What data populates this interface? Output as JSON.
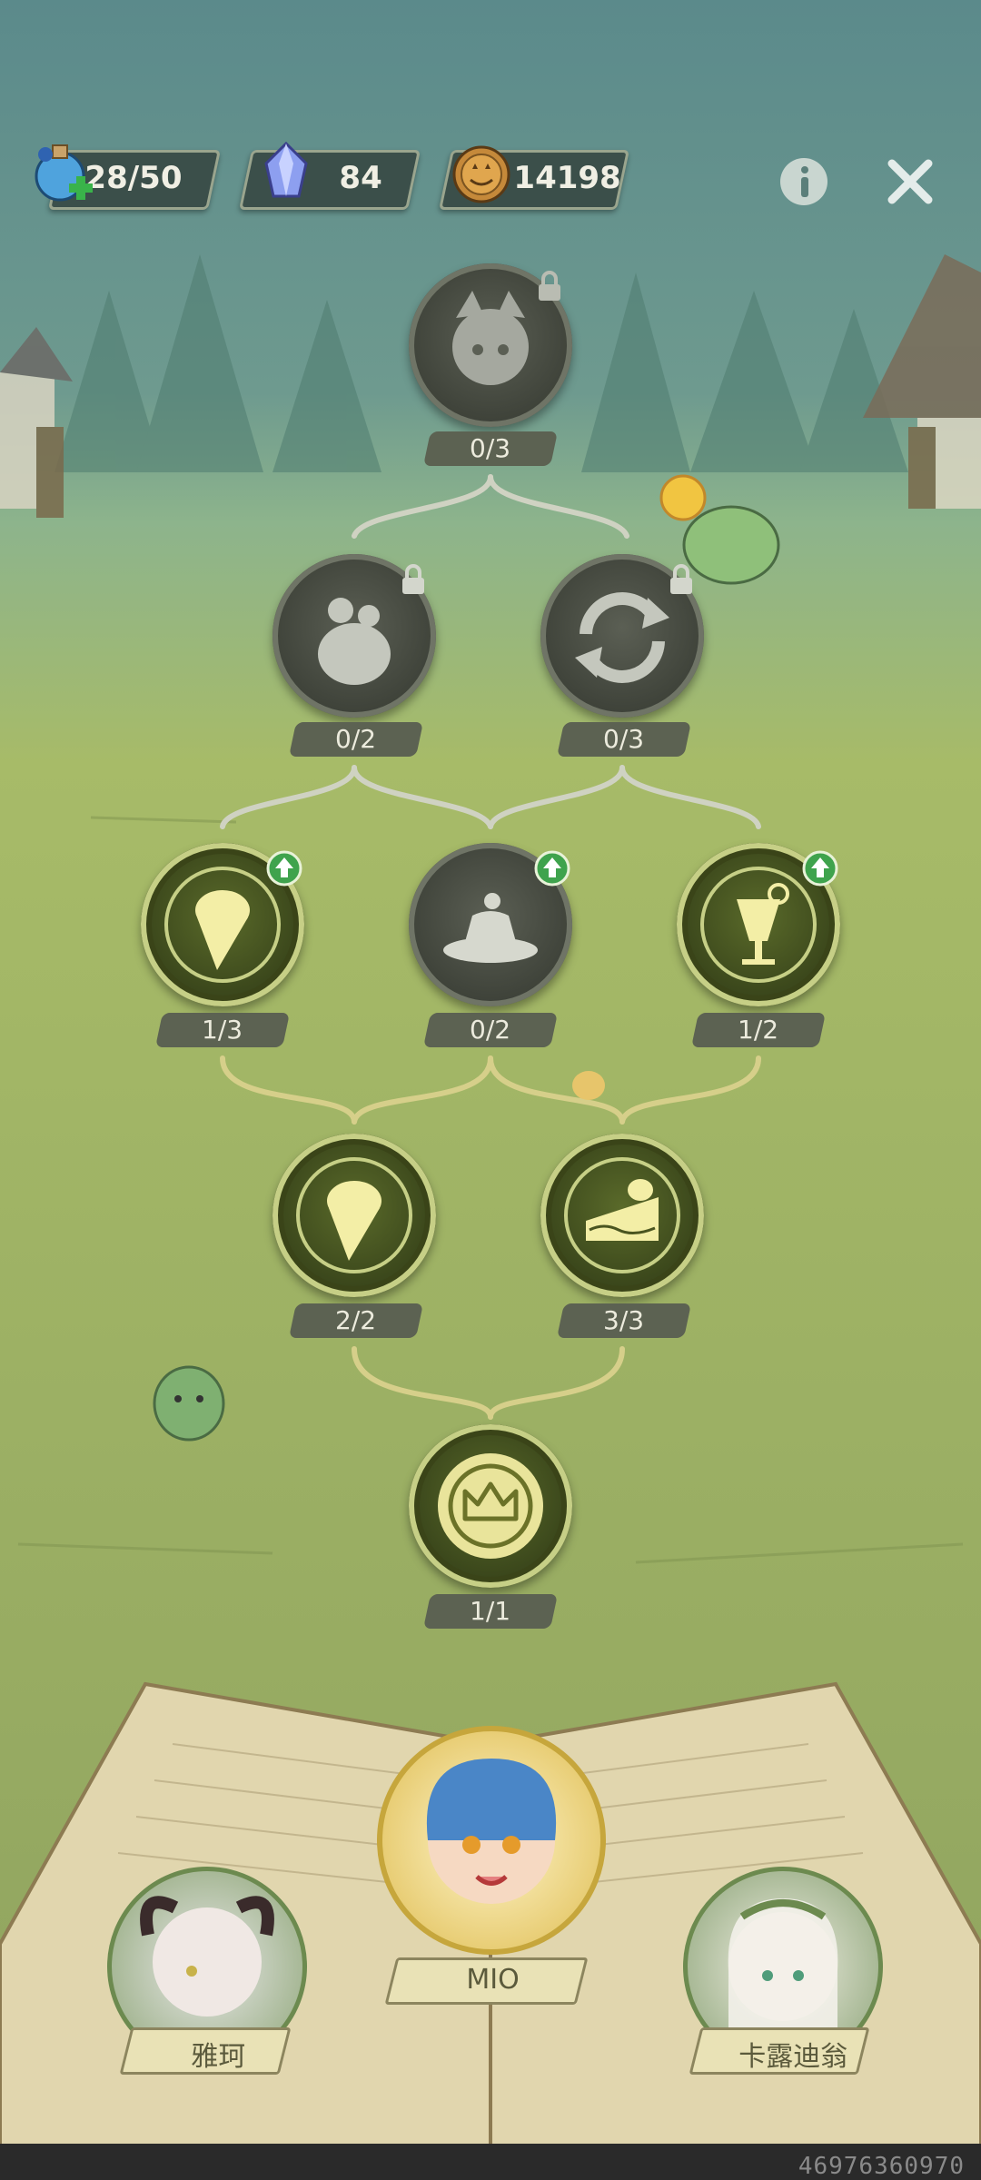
{
  "resources": {
    "stamina": "28/50",
    "crystals": "84",
    "coins": "14198"
  },
  "nodes": {
    "top": "0/3",
    "row2_left": "0/2",
    "row2_right": "0/3",
    "row3_left": "1/3",
    "row3_mid": "0/2",
    "row3_right": "1/2",
    "row4_left": "2/2",
    "row4_right": "3/3",
    "root": "1/1"
  },
  "characters": {
    "left": "雅珂",
    "center": "MIO",
    "right": "卡露迪翁"
  },
  "footer_id": "46976360970",
  "icons": {
    "stamina": "potion-icon",
    "crystals": "crystal-icon",
    "coins": "pumpkin-coin-icon",
    "info": "info-icon",
    "close": "close-icon"
  }
}
